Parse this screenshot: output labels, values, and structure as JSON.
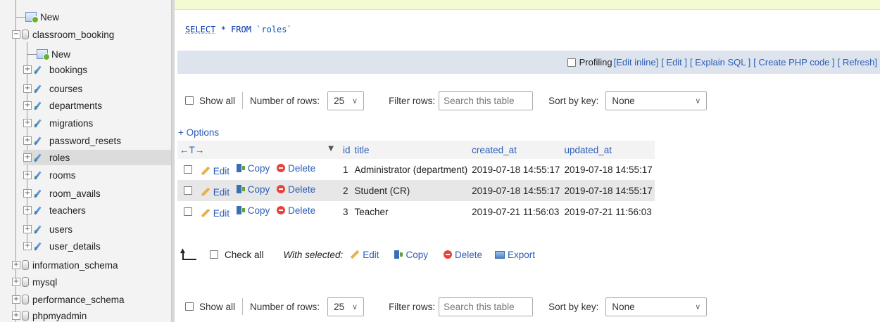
{
  "sidebar": {
    "items": [
      {
        "label": "New",
        "kind": "new",
        "level": 0
      },
      {
        "label": "classroom_booking",
        "kind": "db",
        "level": 0,
        "expanded": true
      },
      {
        "label": "New",
        "kind": "new",
        "level": 1
      },
      {
        "label": "bookings",
        "kind": "table",
        "level": 1
      },
      {
        "label": "courses",
        "kind": "table",
        "level": 1
      },
      {
        "label": "departments",
        "kind": "table",
        "level": 1
      },
      {
        "label": "migrations",
        "kind": "table",
        "level": 1
      },
      {
        "label": "password_resets",
        "kind": "table",
        "level": 1
      },
      {
        "label": "roles",
        "kind": "table",
        "level": 1,
        "active": true
      },
      {
        "label": "rooms",
        "kind": "table",
        "level": 1
      },
      {
        "label": "room_avails",
        "kind": "table",
        "level": 1
      },
      {
        "label": "teachers",
        "kind": "table",
        "level": 1
      },
      {
        "label": "users",
        "kind": "table",
        "level": 1
      },
      {
        "label": "user_details",
        "kind": "table",
        "level": 1
      },
      {
        "label": "information_schema",
        "kind": "db",
        "level": 0
      },
      {
        "label": "mysql",
        "kind": "db",
        "level": 0
      },
      {
        "label": "performance_schema",
        "kind": "db",
        "level": 0
      },
      {
        "label": "phpmyadmin",
        "kind": "db",
        "level": 0
      }
    ]
  },
  "query": {
    "keyword": "SELECT",
    "rest": " * FROM ",
    "table": "`roles`"
  },
  "profiling": {
    "label": "Profiling",
    "links": [
      "[Edit inline]",
      "[ Edit ]",
      "[ Explain SQL ]",
      "[ Create PHP code ]",
      "[ Refresh]"
    ]
  },
  "nav": {
    "show_all": "Show all",
    "rows_label": "Number of rows:",
    "rows_value": "25",
    "filter_label": "Filter rows:",
    "filter_placeholder": "Search this table",
    "sort_label": "Sort by key:",
    "sort_value": "None"
  },
  "options_label": "+ Options",
  "table": {
    "resize_arrows": "←T→",
    "sort_indicator": "▼",
    "columns": [
      "id",
      "title",
      "created_at",
      "updated_at"
    ],
    "row_actions": {
      "edit": "Edit",
      "copy": "Copy",
      "delete": "Delete"
    },
    "rows": [
      {
        "id": "1",
        "title": "Administrator (department)",
        "created_at": "2019-07-18 14:55:17",
        "updated_at": "2019-07-18 14:55:17"
      },
      {
        "id": "2",
        "title": "Student (CR)",
        "created_at": "2019-07-18 14:55:17",
        "updated_at": "2019-07-18 14:55:17"
      },
      {
        "id": "3",
        "title": "Teacher",
        "created_at": "2019-07-21 11:56:03",
        "updated_at": "2019-07-21 11:56:03"
      }
    ]
  },
  "bulk": {
    "check_all": "Check all",
    "with_selected": "With selected:",
    "edit": "Edit",
    "copy": "Copy",
    "delete": "Delete",
    "export": "Export"
  },
  "colors": {
    "link": "#2c5db8",
    "profiling_bar": "#dde4ed",
    "top_strip": "#f5fbd1"
  }
}
